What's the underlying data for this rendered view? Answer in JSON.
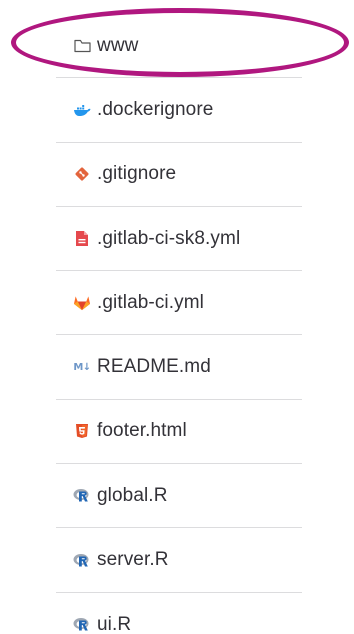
{
  "files": [
    {
      "name": "www",
      "icon": "folder-icon",
      "type": "folder"
    },
    {
      "name": ".dockerignore",
      "icon": "docker-icon",
      "type": "file"
    },
    {
      "name": ".gitignore",
      "icon": "git-icon",
      "type": "file"
    },
    {
      "name": ".gitlab-ci-sk8.yml",
      "icon": "yaml-file-icon",
      "type": "file"
    },
    {
      "name": ".gitlab-ci.yml",
      "icon": "gitlab-icon",
      "type": "file"
    },
    {
      "name": "README.md",
      "icon": "markdown-icon",
      "type": "file"
    },
    {
      "name": "footer.html",
      "icon": "html5-icon",
      "type": "file"
    },
    {
      "name": "global.R",
      "icon": "r-language-icon",
      "type": "file"
    },
    {
      "name": "server.R",
      "icon": "r-language-icon",
      "type": "file"
    },
    {
      "name": "ui.R",
      "icon": "r-language-icon",
      "type": "file"
    }
  ],
  "colors": {
    "highlight": "#b0177f",
    "text": "#333238",
    "divider": "#dcdcde",
    "docker": "#2396ed",
    "git": "#e3643c",
    "yaml": "#e5484d",
    "gitlab": "#fc6d26",
    "markdown": "#6e97c8",
    "html5": "#e44d26",
    "r": "#2166b4"
  }
}
